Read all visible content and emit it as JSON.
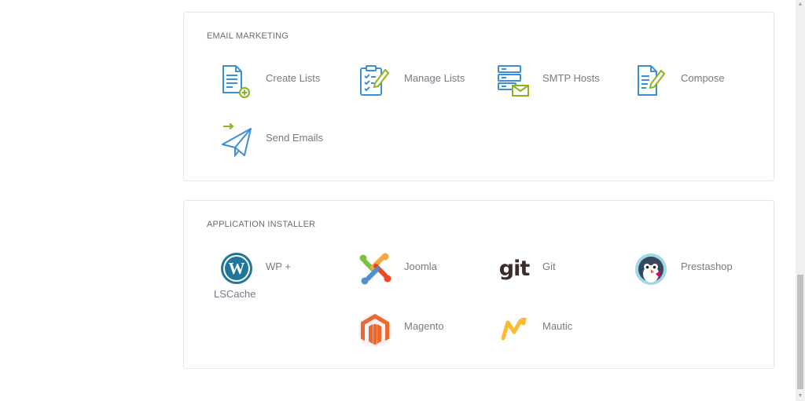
{
  "email_marketing": {
    "title": "EMAIL MARKETING",
    "items": [
      {
        "label": "Create Lists",
        "icon": "create-list-icon"
      },
      {
        "label": "Manage Lists",
        "icon": "manage-list-icon"
      },
      {
        "label": "SMTP Hosts",
        "icon": "smtp-server-icon"
      },
      {
        "label": "Compose",
        "icon": "compose-icon"
      },
      {
        "label": "Send Emails",
        "icon": "paper-plane-icon"
      }
    ]
  },
  "application_installer": {
    "title": "APPLICATION INSTALLER",
    "items": [
      {
        "label": "WP +",
        "label2": "LSCache",
        "icon": "wordpress-icon"
      },
      {
        "label": "Joomla",
        "icon": "joomla-icon"
      },
      {
        "label": "Git",
        "icon": "git-icon"
      },
      {
        "label": "Prestashop",
        "icon": "prestashop-icon"
      },
      {
        "label": "Magento",
        "icon": "magento-icon"
      },
      {
        "label": "Mautic",
        "icon": "mautic-icon"
      }
    ]
  },
  "colors": {
    "icon_blue": "#3a8fd6",
    "icon_green": "#8bb31d",
    "wordpress": "#21759b",
    "magento": "#ee672f",
    "mautic": "#fdb933"
  }
}
